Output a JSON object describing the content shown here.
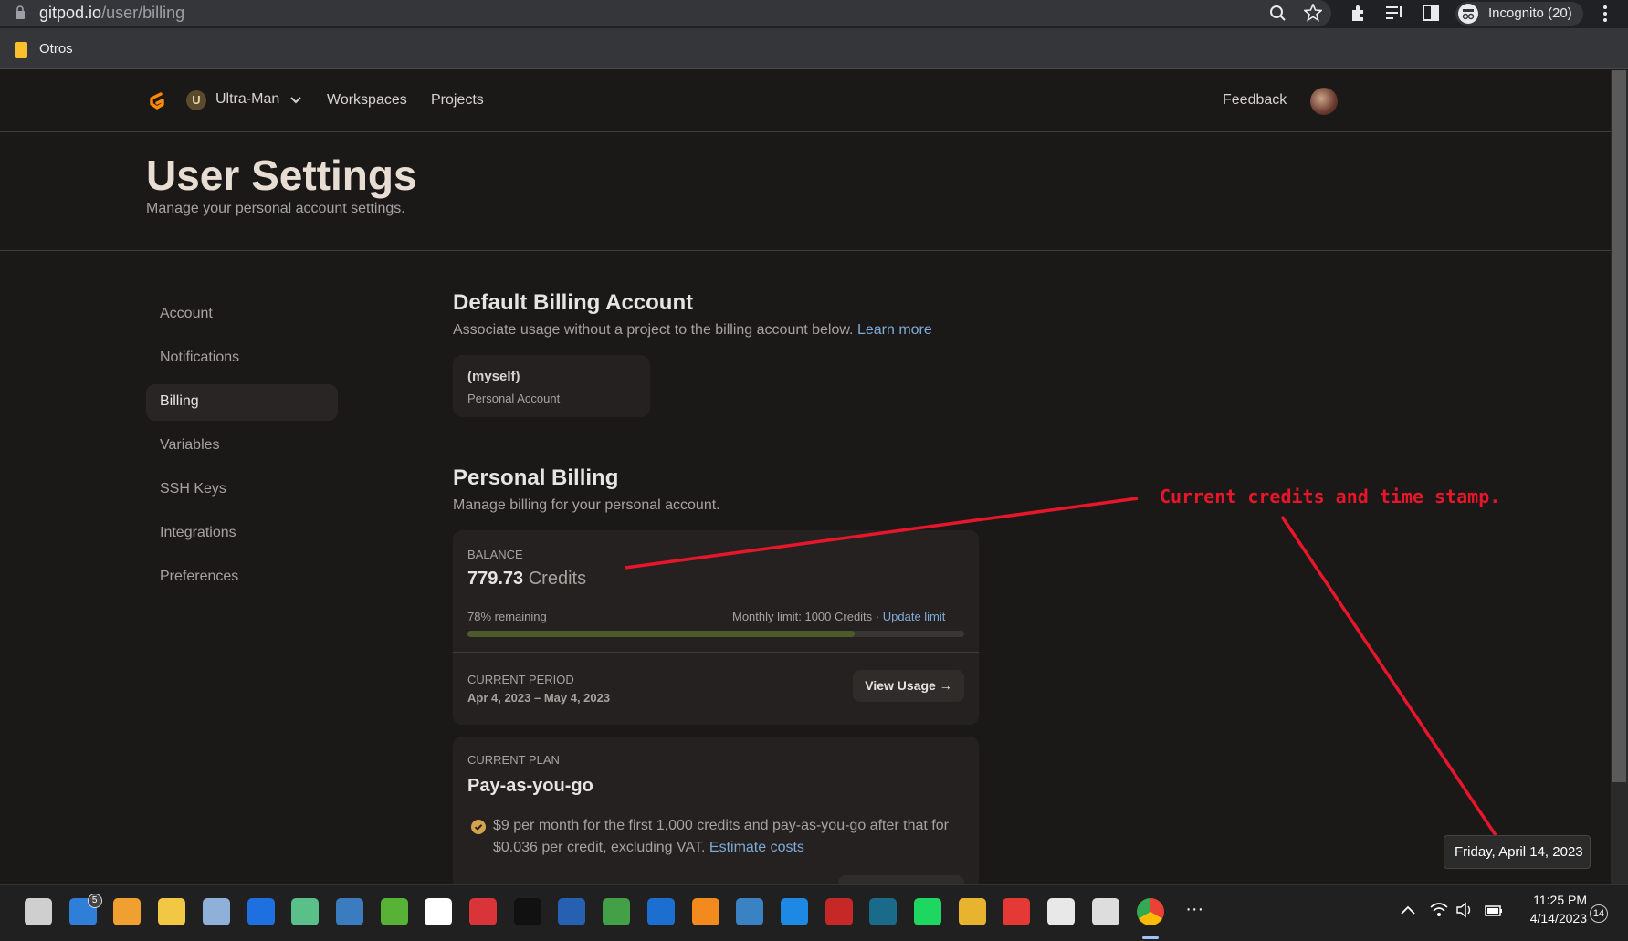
{
  "browser": {
    "url_host": "gitpod.io",
    "url_path": "/user/billing",
    "profile_label": "Incognito (20)",
    "bookmark_folder": "Otros"
  },
  "topnav": {
    "org_initial": "U",
    "org_name": "Ultra-Man",
    "links": [
      "Workspaces",
      "Projects"
    ],
    "feedback": "Feedback"
  },
  "header": {
    "title": "User Settings",
    "subtitle": "Manage your personal account settings."
  },
  "sidebar": {
    "items": [
      {
        "label": "Account",
        "active": false
      },
      {
        "label": "Notifications",
        "active": false
      },
      {
        "label": "Billing",
        "active": true
      },
      {
        "label": "Variables",
        "active": false
      },
      {
        "label": "SSH Keys",
        "active": false
      },
      {
        "label": "Integrations",
        "active": false
      },
      {
        "label": "Preferences",
        "active": false
      }
    ]
  },
  "default_billing": {
    "title": "Default Billing Account",
    "description": "Associate usage without a project to the billing account below.",
    "learn_more": "Learn more",
    "account_name": "(myself)",
    "account_type": "Personal Account"
  },
  "personal_billing": {
    "title": "Personal Billing",
    "description": "Manage billing for your personal account.",
    "balance_label": "BALANCE",
    "balance_value": "779.73",
    "balance_unit": "Credits",
    "remaining_text": "78% remaining",
    "remaining_fraction": 0.78,
    "monthly_limit": "Monthly limit: 1000 Credits ·",
    "update_limit": "Update limit",
    "period_label": "CURRENT PERIOD",
    "period_value": "Apr 4, 2023 – May 4, 2023",
    "view_usage": "View Usage →",
    "plan_label": "CURRENT PLAN",
    "plan_name": "Pay-as-you-go",
    "plan_desc_1": "$9 per month for the first 1,000 credits and pay-as-you-go after that for",
    "plan_desc_2": "$0.036 per credit, excluding VAT.",
    "estimate_costs": "Estimate costs"
  },
  "annotation": {
    "text": "Current credits and time stamp.",
    "color": "#e8162b"
  },
  "tooltip": {
    "text": "Friday, April 14, 2023"
  },
  "taskbar": {
    "mail_badge": "5",
    "time": "11:25 PM",
    "date": "4/14/2023",
    "notification_count": "14",
    "apps": [
      "task-view",
      "mail",
      "remote-desktop",
      "file-explorer",
      "photos",
      "dropbox",
      "atom",
      "python",
      "utorrent",
      "nordvpn",
      "filezilla-z",
      "terminal",
      "powershell",
      "vim",
      "shark",
      "sublime",
      "edge-dev",
      "vscode",
      "filezilla",
      "intellij",
      "spotify",
      "winamp",
      "git",
      "slack",
      "ascgen",
      "chrome",
      "more"
    ]
  },
  "colors": {
    "accent_orange": "#ff8a00",
    "progress_fill": "#4d5a2c",
    "check_badge": "#d4a24c"
  }
}
